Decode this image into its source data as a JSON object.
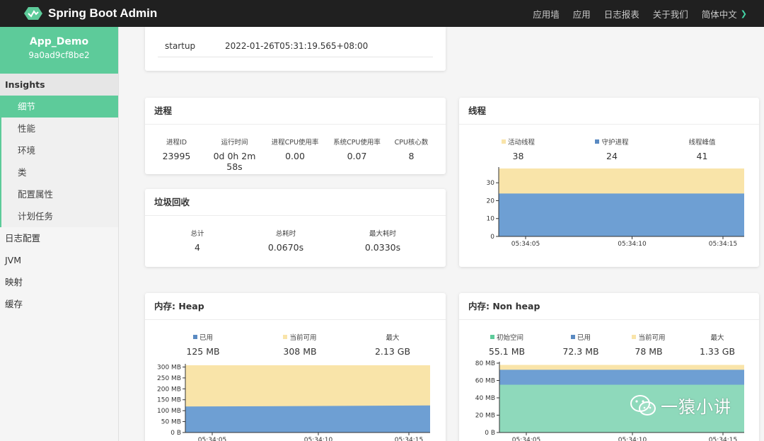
{
  "topbar": {
    "brand": "Spring Boot Admin",
    "nav": [
      "应用墙",
      "应用",
      "日志报表",
      "关于我们",
      "简体中文"
    ]
  },
  "sidebar": {
    "app_name": "App_Demo",
    "app_id": "9a0ad9cf8be2",
    "section": "Insights",
    "sub_items": [
      "细节",
      "性能",
      "环境",
      "类",
      "配置属性",
      "计划任务"
    ],
    "items": [
      "日志配置",
      "JVM",
      "映射",
      "缓存"
    ]
  },
  "startup": {
    "label": "startup",
    "value": "2022-01-26T05:31:19.565+08:00"
  },
  "process": {
    "title": "进程",
    "labels": [
      "进程ID",
      "运行时间",
      "进程CPU使用率",
      "系统CPU使用率",
      "CPU核心数"
    ],
    "values": [
      "23995",
      "0d 0h 2m 58s",
      "0.00",
      "0.07",
      "8"
    ]
  },
  "gc": {
    "title": "垃圾回收",
    "labels": [
      "总计",
      "总耗时",
      "最大耗时"
    ],
    "values": [
      "4",
      "0.0670s",
      "0.0330s"
    ]
  },
  "threads": {
    "title": "线程",
    "labels": [
      "活动线程",
      "守护进程",
      "线程峰值"
    ],
    "values": [
      "38",
      "24",
      "41"
    ]
  },
  "heap": {
    "title": "内存: Heap",
    "labels": [
      "已用",
      "当前可用",
      "最大"
    ],
    "values": [
      "125 MB",
      "308 MB",
      "2.13 GB"
    ]
  },
  "nonheap": {
    "title": "内存: Non heap",
    "labels": [
      "初始空间",
      "已用",
      "当前可用",
      "最大"
    ],
    "values": [
      "55.1 MB",
      "72.3 MB",
      "78 MB",
      "1.33 GB"
    ]
  },
  "colors": {
    "used": "#6e9fd3",
    "available": "#f9e4a9",
    "init": "#8ed9bb",
    "accent": "#5dcb9a"
  },
  "watermark": "一猿小讲",
  "chart_data": [
    {
      "type": "area",
      "title": "线程",
      "x": [
        "05:34:05",
        "05:34:10",
        "05:34:15"
      ],
      "ylim": [
        0,
        38
      ],
      "yticks": [
        "0",
        "10",
        "20",
        "30"
      ],
      "series": [
        {
          "name": "守护进程",
          "values": [
            24,
            24,
            24
          ]
        },
        {
          "name": "活动线程",
          "values": [
            38,
            38,
            38
          ]
        }
      ]
    },
    {
      "type": "area",
      "title": "内存: Heap",
      "x": [
        "05:34:05",
        "05:34:10",
        "05:34:15"
      ],
      "ylim": [
        0,
        308
      ],
      "yticks": [
        "0 B",
        "50 MB",
        "100 MB",
        "150 MB",
        "200 MB",
        "250 MB",
        "300 MB"
      ],
      "series": [
        {
          "name": "已用",
          "values": [
            119,
            121,
            124
          ]
        },
        {
          "name": "当前可用",
          "values": [
            308,
            308,
            308
          ]
        }
      ]
    },
    {
      "type": "area",
      "title": "内存: Non heap",
      "x": [
        "05:34:05",
        "05:34:10",
        "05:34:15"
      ],
      "ylim": [
        0,
        80
      ],
      "yticks": [
        "0 B",
        "20 MB",
        "40 MB",
        "60 MB",
        "80 MB"
      ],
      "series": [
        {
          "name": "初始空间",
          "values": [
            55.1,
            55.1,
            55.1
          ]
        },
        {
          "name": "已用",
          "values": [
            72.3,
            72.3,
            72.3
          ]
        },
        {
          "name": "当前可用",
          "values": [
            78,
            78,
            78
          ]
        }
      ]
    }
  ]
}
